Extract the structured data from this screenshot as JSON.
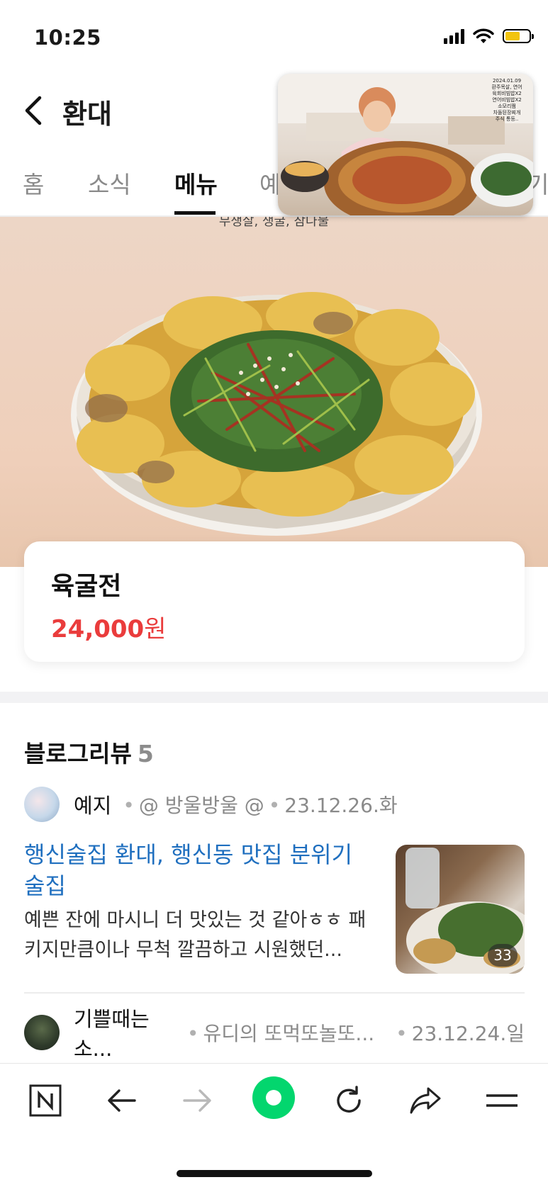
{
  "status_bar": {
    "time": "10:25",
    "battery_level": 0.62
  },
  "header": {
    "title": "환대"
  },
  "tabs": [
    {
      "label": "홈",
      "active": false
    },
    {
      "label": "소식",
      "active": false
    },
    {
      "label": "메뉴",
      "active": true
    },
    {
      "label": "예",
      "active": false
    }
  ],
  "tab_partial_right": "기드",
  "video": {
    "caption_lines": [
      "2024.01.09",
      "환주목살, 연어",
      "육회비빔밥X2",
      "연어비빔밥X2",
      "소모리쩜",
      "차돌된장찌개",
      "주식 통등.."
    ]
  },
  "hero": {
    "caption": "무생살, 생굴, 참나물"
  },
  "menu": {
    "name": "육굴전",
    "price_number": "24,000",
    "price_unit": "원"
  },
  "blog_section": {
    "title": "블로그리뷰",
    "count": "5"
  },
  "reviews": [
    {
      "author": "예지",
      "blog": "@ 방울방울 @",
      "date": "23.12.26.화",
      "title": "행신술집 환대, 행신동 맛집 분위기 술집",
      "snippet": "예쁜 잔에 마시니 더 맛있는 것 같아ㅎㅎ 패키지만큼이나 무척 깔끔하고 시원했던...",
      "photo_count": "33"
    },
    {
      "author": "기쁠때는소...",
      "blog": "유디의 또먹또놀또...",
      "date": "23.12.24.일"
    }
  ],
  "bottom_nav": [
    {
      "icon": "naver-home-icon"
    },
    {
      "icon": "back-arrow-icon"
    },
    {
      "icon": "forward-arrow-icon"
    },
    {
      "icon": "green-dot-icon"
    },
    {
      "icon": "refresh-icon"
    },
    {
      "icon": "share-icon"
    },
    {
      "icon": "menu-icon"
    }
  ],
  "colors": {
    "price": "#ea3c3c",
    "link": "#1f6fbf",
    "green_button": "#03d66e"
  }
}
